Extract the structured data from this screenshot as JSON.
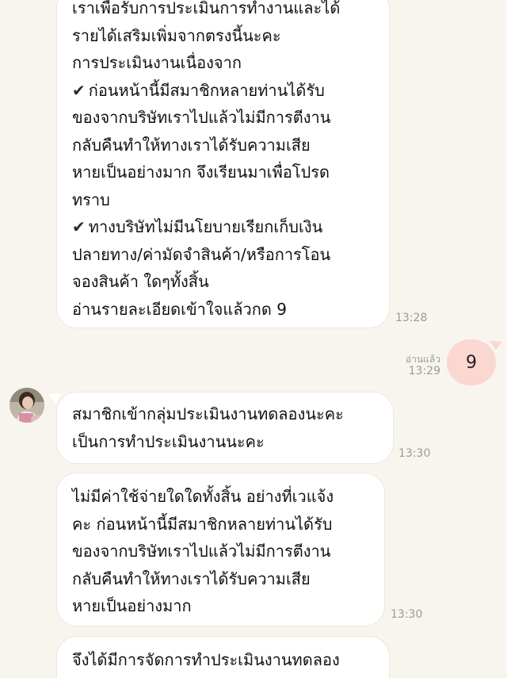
{
  "messages": {
    "m1": {
      "lines": [
        "เราเพื่อรับการประเมินการทำงานและได้",
        "รายได้เสริมเพิ่มจากตรงนี้นะคะ",
        "การประเมินงานเนื่องจาก",
        "ก่อนหน้านี้มีสมาชิกหลายท่านได้รับ",
        "ของจากบริษัทเราไปแล้วไม่มีการตีงาน",
        "กลับคืนทำให้ทางเราได้รับความเสีย",
        "หายเป็นอย่างมาก จึงเรียนมาเพื่อโปรด",
        "ทราบ",
        "ทางบริษัทไม่มีนโยบายเรียกเก็บเงิน",
        "ปลายทาง/ค่ามัดจำสินค้า/หรือการโอน",
        "จองสินค้า ใดๆทั้งสิ้น",
        "อ่านรายละเอียดเข้าใจแล้วกด 9"
      ],
      "check_mark": "✔",
      "time": "13:28"
    },
    "m2": {
      "text": "9",
      "read_label": "อ่านแล้ว",
      "time": "13:29"
    },
    "m3": {
      "lines": [
        "สมาชิกเข้ากลุ่มประเมินงานทดลองนะคะ",
        "เป็นการทำประเมินงานนะคะ"
      ],
      "time": "13:30"
    },
    "m4": {
      "lines": [
        "ไม่มีค่าใช้จ่ายใดใดทั้งสิ้น อย่างที่เวแจ้ง",
        "คะ ก่อนหน้านี้มีสมาชิกหลายท่านได้รับ",
        "ของจากบริษัทเราไปแล้วไม่มีการตีงาน",
        "กลับคืนทำให้ทางเราได้รับความเสีย",
        "หายเป็นอย่างมาก"
      ],
      "time": "13:30"
    },
    "m5": {
      "lines": [
        "จึงได้มีการจัดการทำประเมินงานทดลอง"
      ]
    }
  },
  "colors": {
    "background": "#f7f5ee",
    "incoming_bubble": "#ffffff",
    "outgoing_bubble": "#fbd7d2",
    "timestamp": "#9a9a9a"
  },
  "icons": {
    "check": "check-icon",
    "avatar": "contact-avatar"
  }
}
